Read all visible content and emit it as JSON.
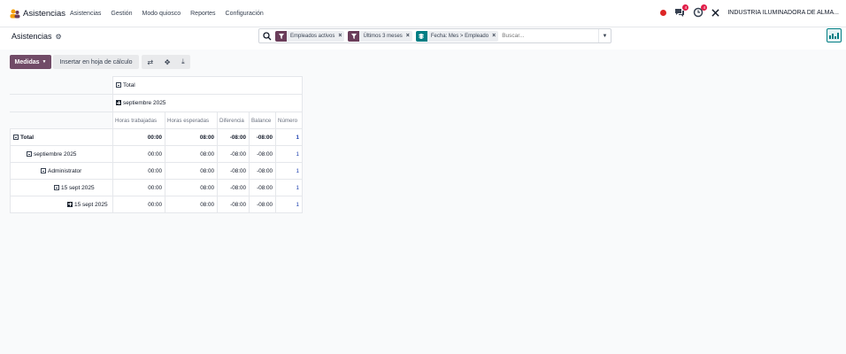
{
  "app": {
    "name": "Asistencias",
    "menu": [
      "Asistencias",
      "Gestión",
      "Modo quiosco",
      "Reportes",
      "Configuración"
    ],
    "badges": {
      "messages": "4",
      "activities": "4"
    },
    "company": "INDUSTRIA ILUMINADORA DE ALMA..."
  },
  "control": {
    "title": "Asistencias",
    "facets": [
      {
        "label": "Empleados activos",
        "kind": "filter"
      },
      {
        "label": "Últimos 3 meses",
        "kind": "filter"
      },
      {
        "label": "Fecha: Mes > Empleado",
        "kind": "groupby"
      }
    ],
    "search_placeholder": "Buscar..."
  },
  "toolbar": {
    "measures_label": "Medidas",
    "insert_label": "Insertar en hoja de cálculo"
  },
  "colors": {
    "brand": "#714b67",
    "accent": "#017e84"
  },
  "pivot": {
    "col_total": "Total",
    "col_group": "septiembre 2025",
    "measures": [
      "Horas trabajadas",
      "Horas esperadas",
      "Diferencia",
      "Balance",
      "Número"
    ],
    "rows": [
      {
        "label": "Total",
        "values": [
          "00:00",
          "08:00",
          "-08:00",
          "-08:00",
          "1"
        ]
      },
      {
        "label": "septiembre 2025",
        "values": [
          "00:00",
          "08:00",
          "-08:00",
          "-08:00",
          "1"
        ]
      },
      {
        "label": "Administrator",
        "values": [
          "00:00",
          "08:00",
          "-08:00",
          "-08:00",
          "1"
        ]
      },
      {
        "label": "15 sept 2025",
        "values": [
          "00:00",
          "08:00",
          "-08:00",
          "-08:00",
          "1"
        ]
      },
      {
        "label": "15 sept 2025",
        "values": [
          "00:00",
          "08:00",
          "-08:00",
          "-08:00",
          "1"
        ]
      }
    ]
  }
}
